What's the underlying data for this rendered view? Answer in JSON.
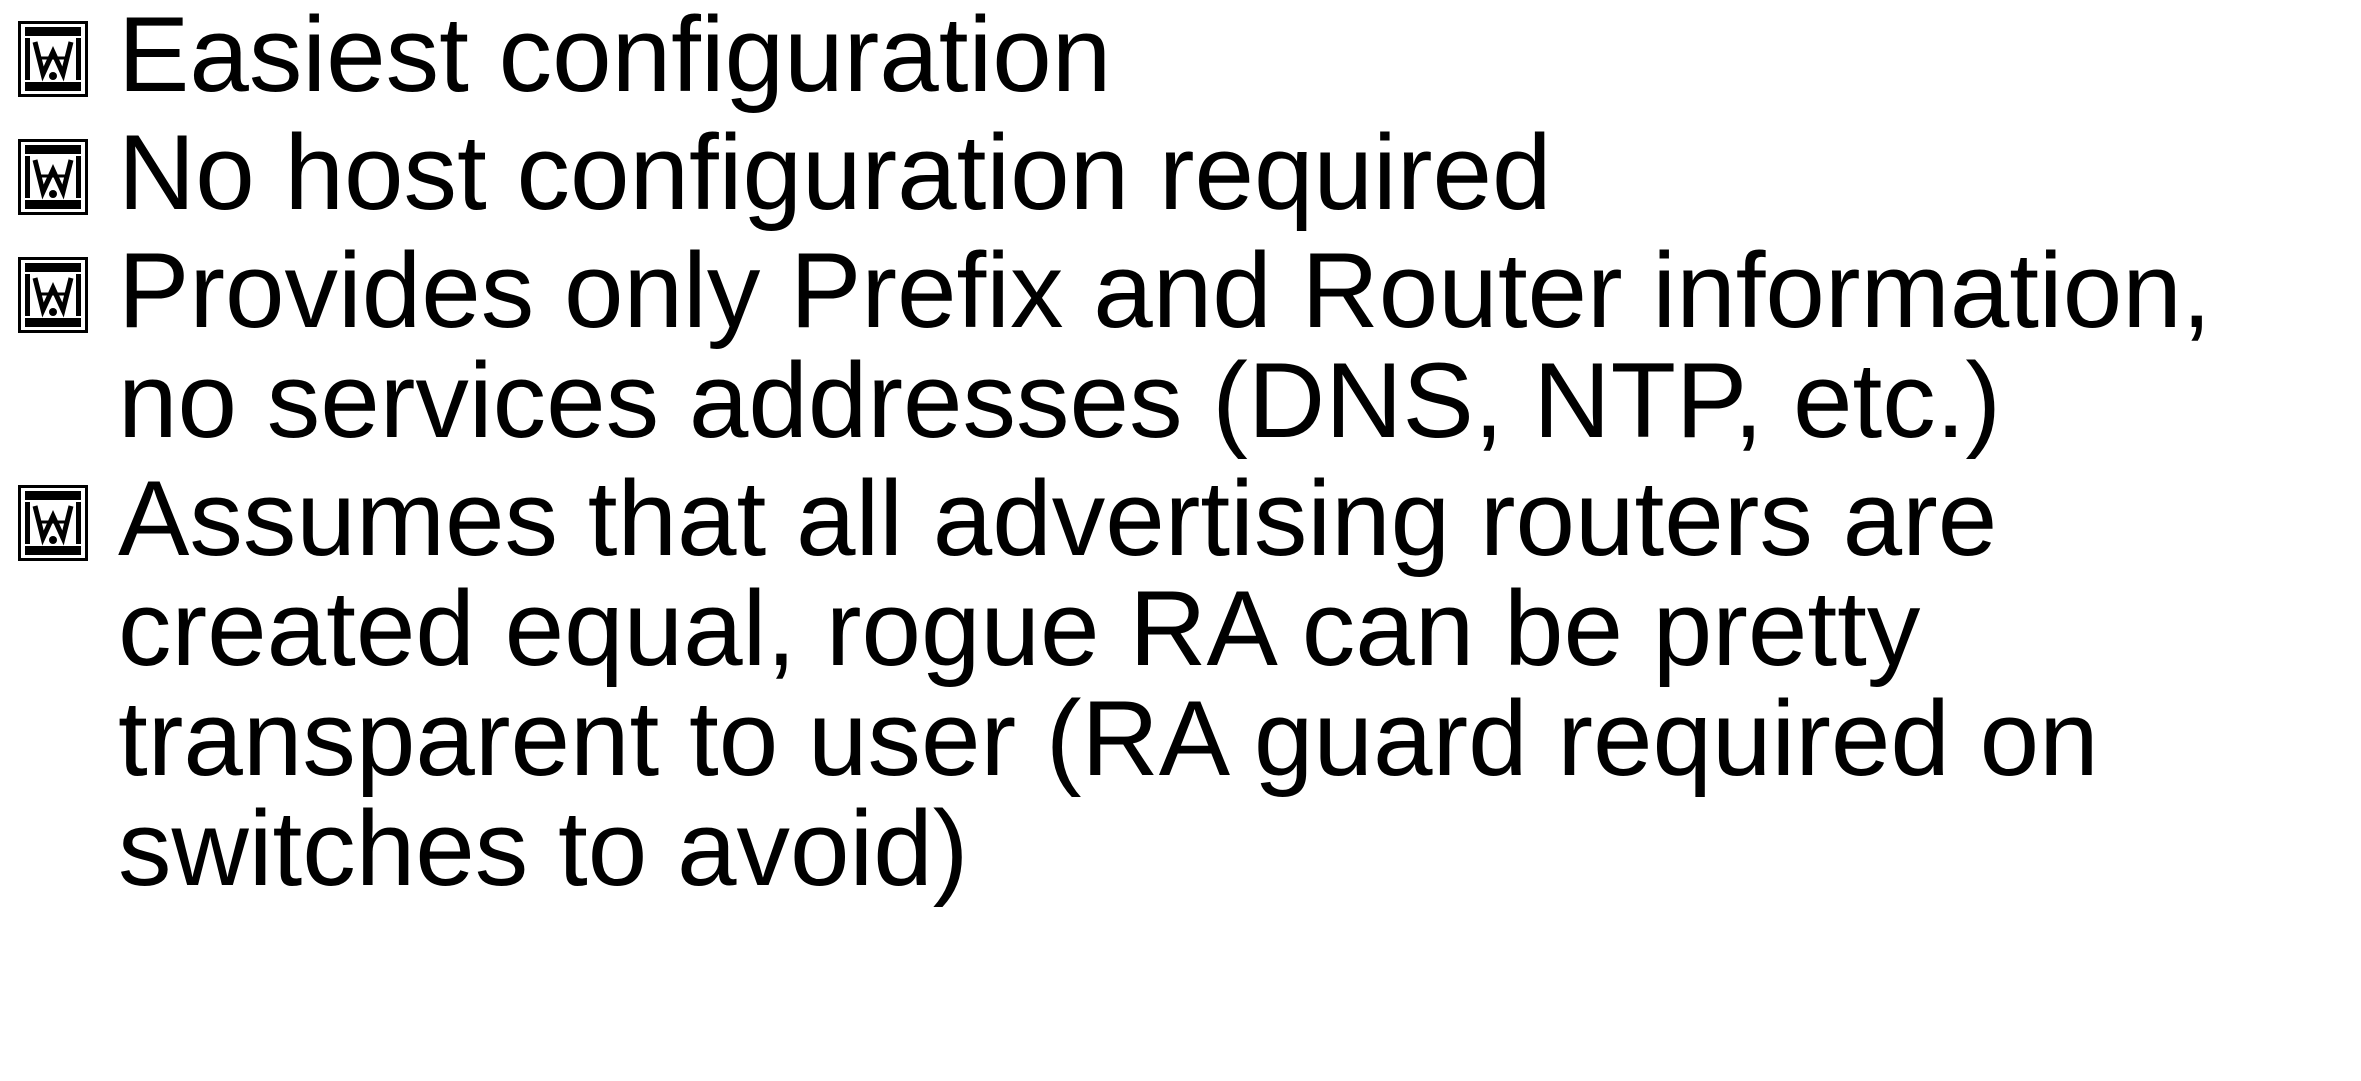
{
  "bullet_icon": "private-use-stamp-icon",
  "stamp_text": "PRIVATE USE",
  "bullets": [
    {
      "lines": [
        "Easiest configuration"
      ]
    },
    {
      "lines": [
        "No host configuration required"
      ]
    },
    {
      "lines": [
        "Provides only Prefix and Router information,",
        "no services addresses (DNS, NTP, etc.)"
      ]
    },
    {
      "lines": [
        "Assumes that all advertising routers are",
        "created equal, rogue RA can be pretty",
        "transparent to user (RA guard required on",
        "switches to avoid)"
      ]
    }
  ]
}
